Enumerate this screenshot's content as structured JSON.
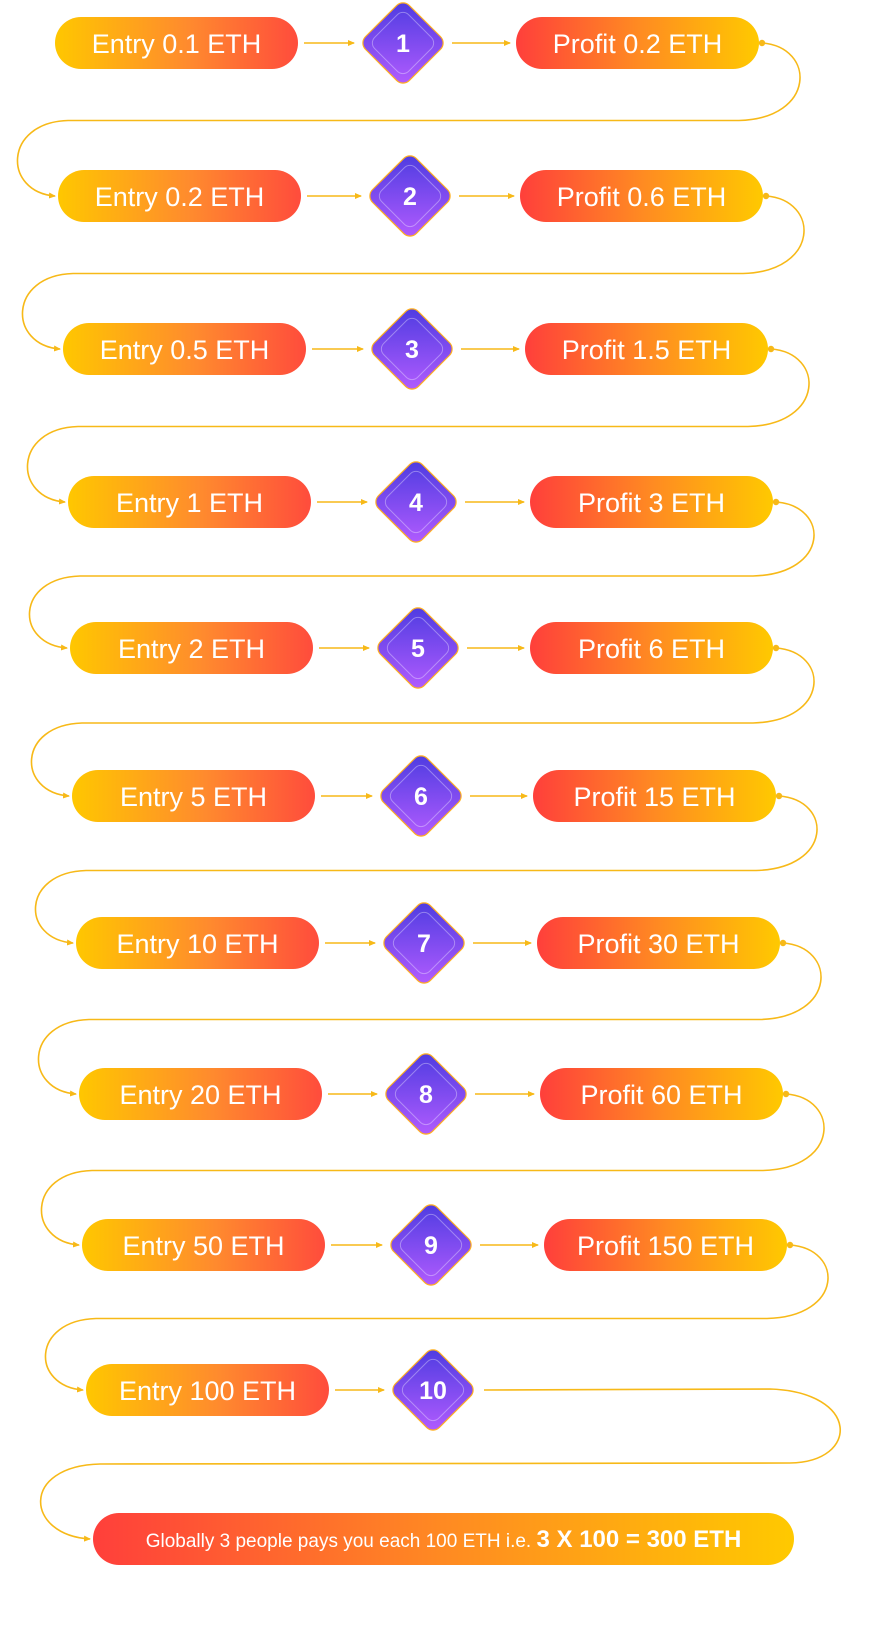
{
  "colors": {
    "connector": "#f7b918",
    "yellow": "#ffc700",
    "orange": "#ff7a2d",
    "red": "#ff3b3b",
    "diamond_light": "#b45cff",
    "diamond_dark": "#4b3be0",
    "diamond_border": "#ffb020"
  },
  "levels": [
    {
      "number": "1",
      "entry": "Entry 0.1 ETH",
      "profit": "Profit 0.2 ETH"
    },
    {
      "number": "2",
      "entry": "Entry 0.2 ETH",
      "profit": "Profit 0.6 ETH"
    },
    {
      "number": "3",
      "entry": "Entry 0.5 ETH",
      "profit": "Profit 1.5 ETH"
    },
    {
      "number": "4",
      "entry": "Entry 1 ETH",
      "profit": "Profit 3 ETH"
    },
    {
      "number": "5",
      "entry": "Entry 2 ETH",
      "profit": "Profit 6 ETH"
    },
    {
      "number": "6",
      "entry": "Entry 5 ETH",
      "profit": "Profit 15 ETH"
    },
    {
      "number": "7",
      "entry": "Entry 10 ETH",
      "profit": "Profit 30 ETH"
    },
    {
      "number": "8",
      "entry": "Entry 20 ETH",
      "profit": "Profit 60 ETH"
    },
    {
      "number": "9",
      "entry": "Entry 50 ETH",
      "profit": "Profit 150 ETH"
    },
    {
      "number": "10",
      "entry": "Entry 100 ETH",
      "profit": ""
    }
  ],
  "final": {
    "prefix": "Globally 3 people pays you each 100 ETH i.e. ",
    "highlight": "3 X 100 = 300 ETH"
  }
}
